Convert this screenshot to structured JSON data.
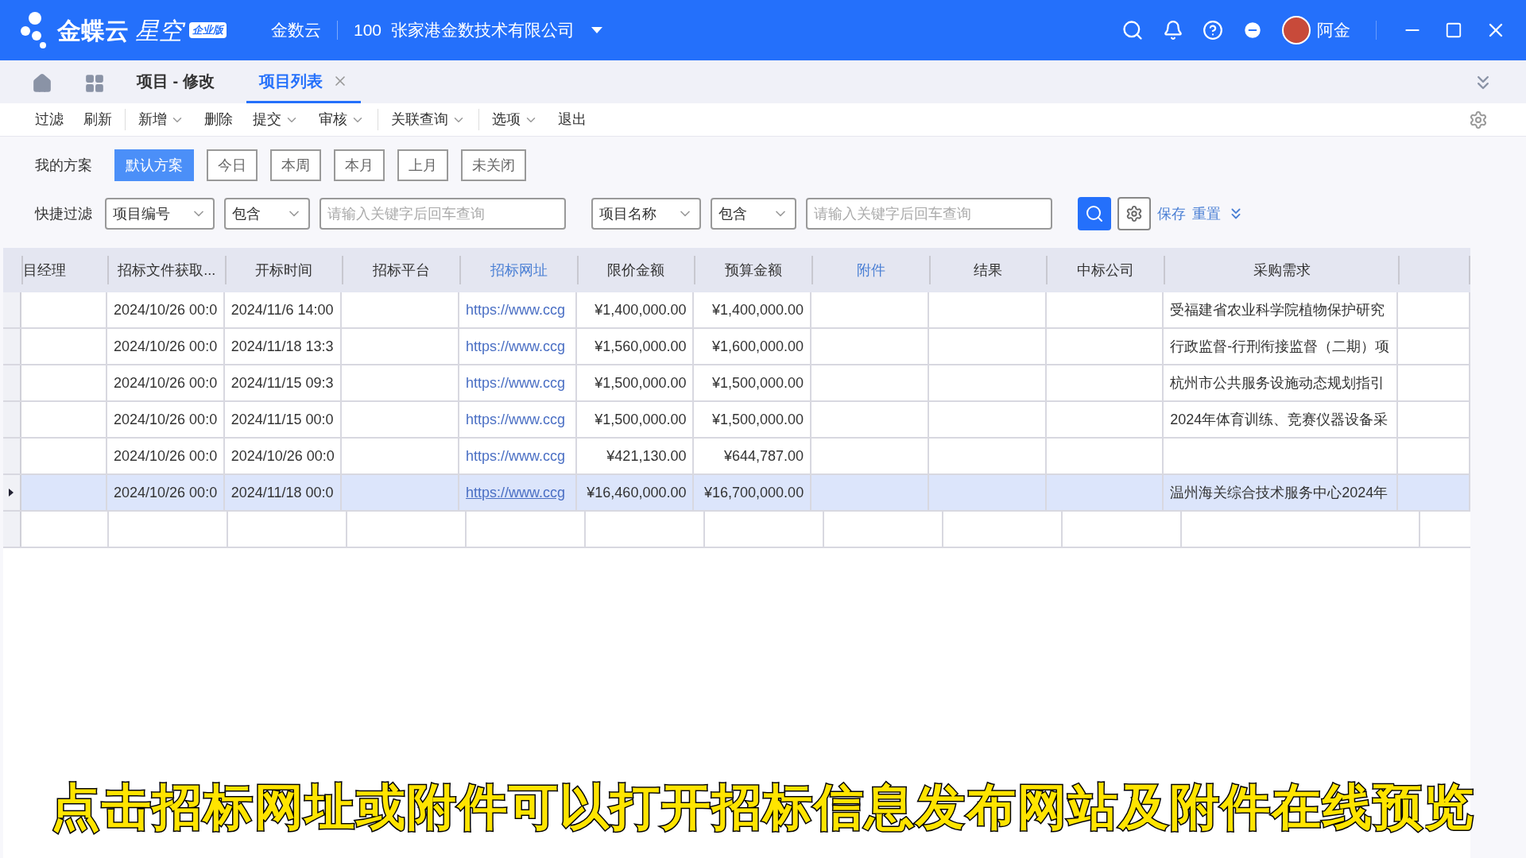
{
  "header": {
    "logo_main": "金蝶云",
    "logo_sub": "星空",
    "edition": "企业版",
    "org": "金数云",
    "company_code": "100",
    "company": "张家港金数技术有限公司",
    "user": "阿金"
  },
  "tabs": [
    {
      "label": "项目 - 修改",
      "selected": false,
      "closable": false
    },
    {
      "label": "项目列表",
      "selected": true,
      "closable": true
    }
  ],
  "toolbar": [
    {
      "label": "过滤",
      "dropdown": false,
      "divider": false
    },
    {
      "label": "刷新",
      "dropdown": false,
      "divider": true
    },
    {
      "label": "新增",
      "dropdown": true,
      "divider": false
    },
    {
      "label": "删除",
      "dropdown": false,
      "divider": false
    },
    {
      "label": "提交",
      "dropdown": true,
      "divider": false
    },
    {
      "label": "审核",
      "dropdown": true,
      "divider": true
    },
    {
      "label": "关联查询",
      "dropdown": true,
      "divider": true
    },
    {
      "label": "选项",
      "dropdown": true,
      "divider": false
    },
    {
      "label": "退出",
      "dropdown": false,
      "divider": false
    }
  ],
  "plans": {
    "label": "我的方案",
    "items": [
      {
        "label": "默认方案",
        "selected": true
      },
      {
        "label": "今日",
        "selected": false
      },
      {
        "label": "本周",
        "selected": false
      },
      {
        "label": "本月",
        "selected": false
      },
      {
        "label": "上月",
        "selected": false
      },
      {
        "label": "未关闭",
        "selected": false
      }
    ]
  },
  "quick_filter": {
    "label": "快捷过滤",
    "filters": [
      {
        "field": "项目编号",
        "operator": "包含",
        "placeholder": "请输入关键字后回车查询"
      },
      {
        "field": "项目名称",
        "operator": "包含",
        "placeholder": "请输入关键字后回车查询"
      }
    ],
    "save": "保存",
    "reset": "重置"
  },
  "table": {
    "columns": [
      {
        "label": "目经理",
        "link": false
      },
      {
        "label": "招标文件获取...",
        "link": false
      },
      {
        "label": "开标时间",
        "link": false
      },
      {
        "label": "招标平台",
        "link": false
      },
      {
        "label": "招标网址",
        "link": true
      },
      {
        "label": "限价金额",
        "link": false
      },
      {
        "label": "预算金额",
        "link": false
      },
      {
        "label": "附件",
        "link": true
      },
      {
        "label": "结果",
        "link": false
      },
      {
        "label": "中标公司",
        "link": false
      },
      {
        "label": "采购需求",
        "link": false
      }
    ],
    "rows": [
      {
        "selected": false,
        "cells": [
          null,
          "2024/10/26 00:0",
          "2024/11/6 14:00",
          null,
          "https://www.ccg",
          "¥1,400,000.00",
          "¥1,400,000.00",
          null,
          null,
          null,
          "受福建省农业科学院植物保护研究"
        ]
      },
      {
        "selected": false,
        "cells": [
          null,
          "2024/10/26 00:0",
          "2024/11/18 13:3",
          null,
          "https://www.ccg",
          "¥1,560,000.00",
          "¥1,600,000.00",
          null,
          null,
          null,
          "行政监督-行刑衔接监督（二期）项"
        ]
      },
      {
        "selected": false,
        "cells": [
          null,
          "2024/10/26 00:0",
          "2024/11/15 09:3",
          null,
          "https://www.ccg",
          "¥1,500,000.00",
          "¥1,500,000.00",
          null,
          null,
          null,
          "杭州市公共服务设施动态规划指引"
        ]
      },
      {
        "selected": false,
        "cells": [
          null,
          "2024/10/26 00:0",
          "2024/11/15 00:0",
          null,
          "https://www.ccg",
          "¥1,500,000.00",
          "¥1,500,000.00",
          null,
          null,
          null,
          "2024年体育训练、竞赛仪器设备采"
        ]
      },
      {
        "selected": false,
        "cells": [
          null,
          "2024/10/26 00:0",
          "2024/10/26 00:0",
          null,
          "https://www.ccg",
          "¥421,130.00",
          "¥644,787.00",
          null,
          null,
          null,
          null
        ]
      },
      {
        "selected": true,
        "cells": [
          null,
          "2024/10/26 00:0",
          "2024/11/18 00:0",
          null,
          "https://www.ccg",
          "¥16,460,000.00",
          "¥16,700,000.00",
          null,
          null,
          null,
          "温州海关综合技术服务中心2024年"
        ]
      }
    ]
  },
  "caption": "点击招标网址或附件可以打开招标信息发布网站及附件在线预览"
}
